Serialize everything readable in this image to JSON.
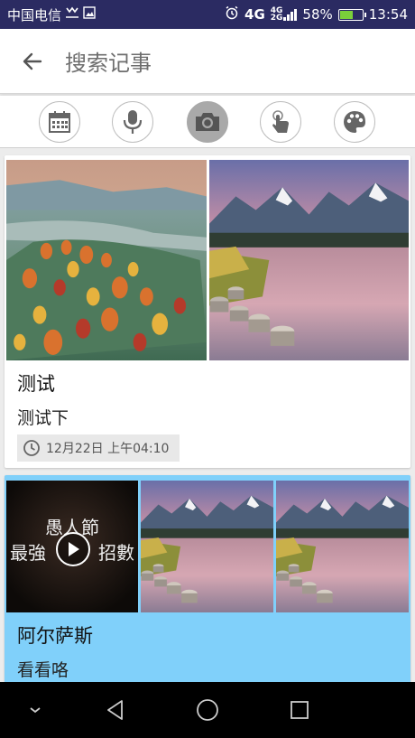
{
  "status_bar": {
    "carrier": "中国电信",
    "network_4g": "4G",
    "network_tag_top": "4G",
    "network_tag_bottom": "2G",
    "battery_percent": "58%",
    "battery_level": 0.58,
    "time": "13:54"
  },
  "header": {
    "title": "搜索记事",
    "back_icon": "arrow-left-icon"
  },
  "toolbar": {
    "tools": [
      {
        "name": "calendar",
        "icon": "calendar-icon",
        "active": false
      },
      {
        "name": "voice",
        "icon": "microphone-icon",
        "active": false
      },
      {
        "name": "camera",
        "icon": "camera-icon",
        "active": true
      },
      {
        "name": "gesture",
        "icon": "touch-icon",
        "active": false
      },
      {
        "name": "palette",
        "icon": "palette-icon",
        "active": false
      }
    ]
  },
  "notes": [
    {
      "title": "测试",
      "body": "测试下",
      "time": "12月22日 上午04:10",
      "background": "#ffffff",
      "images": [
        "autumn-grassland-photo",
        "mountain-lake-photo"
      ]
    },
    {
      "title": "阿尔萨斯",
      "body": "看看咯",
      "background": "#80d0fa",
      "video_caption_line1": "愚人節",
      "video_caption_line2": "最強",
      "video_caption_line2_end": "招數",
      "images": [
        "video-thumbnail",
        "mountain-lake-photo",
        "mountain-lake-photo"
      ]
    }
  ],
  "nav_bar": {
    "icons": [
      "chevron-down-icon",
      "back-triangle-icon",
      "home-circle-icon",
      "recents-square-icon"
    ]
  },
  "colors": {
    "status_bar": "#2b2b62",
    "accent_blue": "#80d0fa",
    "tool_active": "#a9a9a9"
  }
}
